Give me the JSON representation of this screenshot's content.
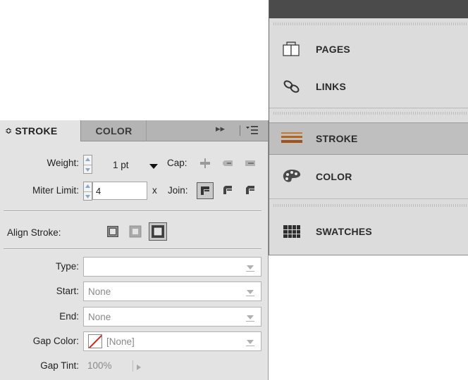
{
  "dock": {
    "items": [
      {
        "label": "PAGES",
        "icon": "pages-icon"
      },
      {
        "label": "LINKS",
        "icon": "links-icon"
      },
      {
        "label": "STROKE",
        "icon": "stroke-icon",
        "active": true
      },
      {
        "label": "COLOR",
        "icon": "palette-icon"
      },
      {
        "label": "SWATCHES",
        "icon": "swatches-icon"
      }
    ]
  },
  "stroke_panel": {
    "tabs": [
      {
        "label": "STROKE",
        "prefix": "≎",
        "active": true
      },
      {
        "label": "COLOR",
        "active": false
      }
    ],
    "weight": {
      "label": "Weight:",
      "value": "1 pt"
    },
    "cap": {
      "label": "Cap:"
    },
    "miter": {
      "label": "Miter Limit:",
      "value": "4",
      "suffix": "x"
    },
    "join": {
      "label": "Join:"
    },
    "align": {
      "label": "Align Stroke:"
    },
    "type": {
      "label": "Type:",
      "value": ""
    },
    "start": {
      "label": "Start:",
      "value": "None"
    },
    "end": {
      "label": "End:",
      "value": "None"
    },
    "gap_color": {
      "label": "Gap Color:",
      "value": "[None]"
    },
    "gap_tint": {
      "label": "Gap Tint:",
      "value": "100%"
    }
  },
  "colors": {
    "accent_stroke_icon": "#b5651d",
    "none_swatch_slash": "#e0201f"
  }
}
